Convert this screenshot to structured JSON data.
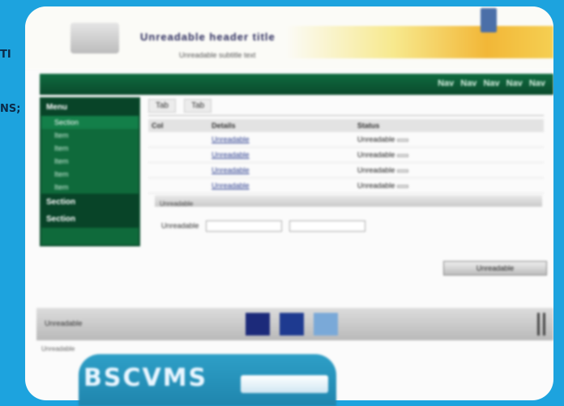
{
  "edge_text": [
    "TI",
    "NS;"
  ],
  "header": {
    "title": "Unreadable header title",
    "subtitle": "Unreadable subtitle text"
  },
  "navbar": {
    "items": [
      "Nav",
      "Nav",
      "Nav",
      "Nav",
      "Nav"
    ]
  },
  "sidebar": {
    "heading": "Menu",
    "items": [
      {
        "label": "Section"
      },
      {
        "label": "Item"
      },
      {
        "label": "Item"
      },
      {
        "label": "Item"
      },
      {
        "label": "Item"
      },
      {
        "label": "Item"
      },
      {
        "label": "Section"
      },
      {
        "label": "Section"
      }
    ]
  },
  "main": {
    "tabs": [
      "Tab",
      "Tab"
    ],
    "table": {
      "headers": [
        "Col",
        "Details",
        "Status"
      ],
      "rows": [
        {
          "c1": "",
          "c2": "Unreadable",
          "c3": "Unreadable"
        },
        {
          "c1": "",
          "c2": "Unreadable",
          "c3": "Unreadable"
        },
        {
          "c1": "",
          "c2": "Unreadable",
          "c3": "Unreadable"
        },
        {
          "c1": "",
          "c2": "Unreadable",
          "c3": "Unreadable"
        }
      ]
    },
    "divider_label": "Unreadable",
    "form_label": "Unreadable",
    "action_button": "Unreadable"
  },
  "taskbar": {
    "label": "Unreadable",
    "boxes": [
      "",
      "",
      ""
    ]
  },
  "footer": "Unreadable",
  "promo": {
    "text": "BSCVMS"
  },
  "colors": {
    "background": "#1da3de",
    "nav_green": "#0f6a3b",
    "banner_gold": "#f2b737"
  }
}
